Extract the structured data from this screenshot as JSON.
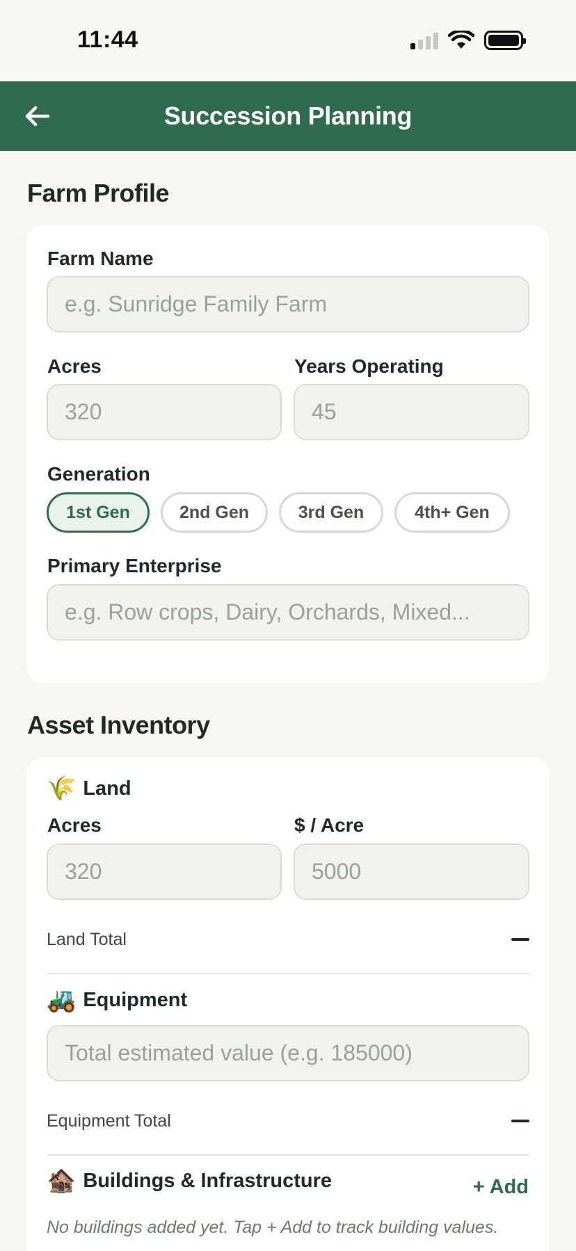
{
  "status_bar": {
    "time": "11:44",
    "icons": [
      "signal-icon",
      "wifi-icon",
      "battery-icon"
    ]
  },
  "header": {
    "title": "Succession Planning",
    "back_icon": "arrow-left-icon"
  },
  "farm_profile": {
    "section_title": "Farm Profile",
    "farm_name": {
      "label": "Farm Name",
      "placeholder": "e.g. Sunridge Family Farm"
    },
    "acres": {
      "label": "Acres",
      "placeholder": "320"
    },
    "years_operating": {
      "label": "Years Operating",
      "placeholder": "45"
    },
    "generation": {
      "label": "Generation",
      "options": [
        "1st Gen",
        "2nd Gen",
        "3rd Gen",
        "4th+ Gen"
      ],
      "selected": "1st Gen"
    },
    "primary_enterprise": {
      "label": "Primary Enterprise",
      "placeholder": "e.g. Row crops, Dairy, Orchards, Mixed..."
    }
  },
  "asset_inventory": {
    "section_title": "Asset Inventory",
    "land": {
      "icon": "🌾",
      "title": "Land",
      "acres": {
        "label": "Acres",
        "placeholder": "320"
      },
      "price_per_acre": {
        "label": "$ / Acre",
        "placeholder": "5000"
      },
      "total_label": "Land Total",
      "total_value": "—"
    },
    "equipment": {
      "icon": "🚜",
      "title": "Equipment",
      "value": {
        "placeholder": "Total estimated value (e.g. 185000)"
      },
      "total_label": "Equipment Total",
      "total_value": "—"
    },
    "buildings": {
      "icon": "🏚️",
      "title": "Buildings & Infrastructure",
      "add_label": "+ Add",
      "empty_note": "No buildings added yet. Tap + Add to track building values."
    }
  },
  "colors": {
    "brand_green": "#2e6b4f",
    "background": "#f6f7f3",
    "card": "#ffffff",
    "input_bg": "#f1f2ee"
  }
}
